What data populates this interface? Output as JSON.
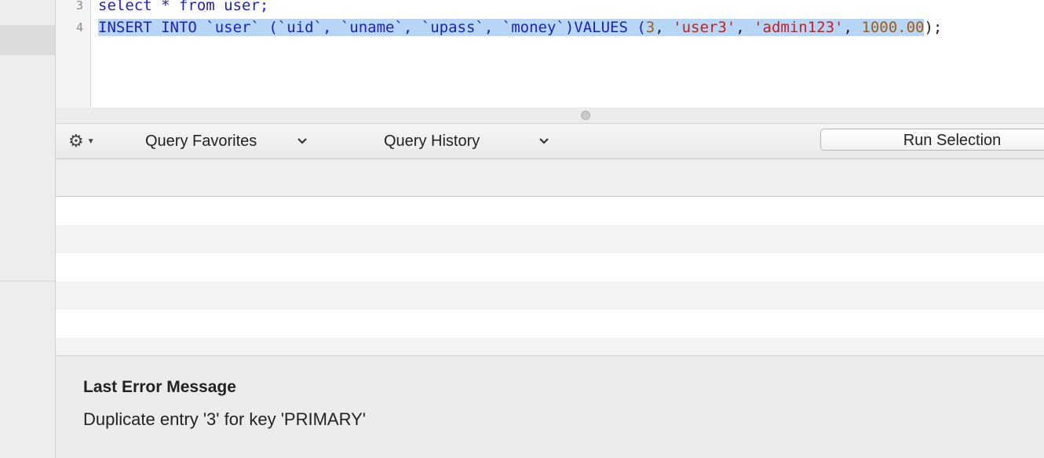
{
  "editor": {
    "line_numbers": [
      "3",
      "4"
    ],
    "line3": {
      "text": "select * from user;"
    },
    "line4": {
      "t1": "INSERT INTO `user` (`uid`, `uname`, `upass`, `money`)VALUES (",
      "t2": "3",
      "t3": ", ",
      "t4": "'user3'",
      "t5": ", ",
      "t6": "'admin123'",
      "t7": ", ",
      "t8": "1000.00",
      "t9": ");"
    }
  },
  "toolbar": {
    "gear_icon": "gear-icon",
    "query_favorites": "Query Favorites",
    "query_history": "Query History",
    "run_selection": "Run Selection"
  },
  "error": {
    "title": "Last Error Message",
    "message": "Duplicate entry '3' for key 'PRIMARY'"
  },
  "colors": {
    "keyword": "#1f1fbd",
    "string": "#c81e1e",
    "number": "#a35c12",
    "selection": "#b7d5f5"
  }
}
